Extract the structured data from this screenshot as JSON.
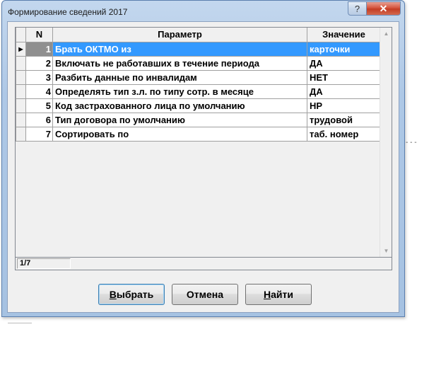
{
  "window": {
    "title": "Формирование сведений 2017",
    "help_glyph": "?",
    "close_glyph": "✕"
  },
  "grid": {
    "columns": [
      "N",
      "Параметр",
      "Значение"
    ],
    "selected_row": 0,
    "rows": [
      {
        "n": "1",
        "param": "Брать ОКТМО из",
        "value": "карточки"
      },
      {
        "n": "2",
        "param": "Включать не работавших в течение периода",
        "value": "ДА"
      },
      {
        "n": "3",
        "param": "Разбить данные по инвалидам",
        "value": "НЕТ"
      },
      {
        "n": "4",
        "param": "Определять тип з.л. по типу сотр. в месяце",
        "value": "ДА"
      },
      {
        "n": "5",
        "param": "Код застрахованного лица по умолчанию",
        "value": "НР"
      },
      {
        "n": "6",
        "param": "Тип договора по умолчанию",
        "value": "трудовой"
      },
      {
        "n": "7",
        "param": "Сортировать по",
        "value": "таб. номер"
      }
    ],
    "row_indicator_icon": "current-row-triangle-icon",
    "scroll_up_icon": "scroll-up-arrow-icon",
    "scroll_down_icon": "scroll-down-arrow-icon"
  },
  "status": {
    "position": "1/7"
  },
  "buttons": {
    "select": {
      "first": "В",
      "rest": "ыбрать"
    },
    "cancel": "Отмена",
    "find": {
      "first": "Н",
      "rest": "айти"
    }
  },
  "colors": {
    "selection": "#3399ff",
    "close_button": "#c43d24"
  }
}
